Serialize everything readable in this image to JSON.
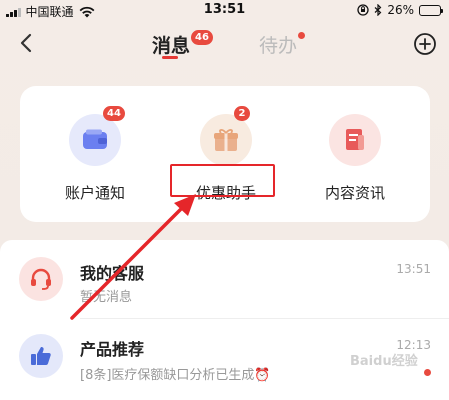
{
  "status_bar": {
    "carrier": "中国联通",
    "time": "13:51",
    "battery_percent": "26%",
    "battery_level": 0.26,
    "icons": [
      "signal-icon",
      "wifi-icon",
      "orientation-lock-icon",
      "bluetooth-icon",
      "battery-icon"
    ]
  },
  "header": {
    "tabs": [
      {
        "label": "消息",
        "badge": "46",
        "active": true
      },
      {
        "label": "待办",
        "dot": true,
        "active": false
      }
    ],
    "back_icon": "chevron-left-icon",
    "add_icon": "plus-circle-icon"
  },
  "quick_actions": [
    {
      "label": "账户通知",
      "badge": "44",
      "icon": "wallet-icon",
      "color": "#6b7ff0"
    },
    {
      "label": "优惠助手",
      "badge": "2",
      "icon": "gift-icon",
      "color": "#e8a57a",
      "highlighted": true
    },
    {
      "label": "内容资讯",
      "icon": "document-icon",
      "color": "#e85a5a"
    }
  ],
  "messages": [
    {
      "title": "我的客服",
      "subtitle": "暂无消息",
      "time": "13:51",
      "icon": "headset-icon",
      "color": "#e84a3f"
    },
    {
      "title": "产品推荐",
      "subtitle": "[8条]医疗保额缺口分析已生成⏰",
      "time": "12:13",
      "icon": "thumbs-up-icon",
      "color": "#4a6bd8",
      "unread_dot": true
    }
  ],
  "annotation": {
    "color": "#e5262a"
  },
  "watermark": "Baidu经验"
}
